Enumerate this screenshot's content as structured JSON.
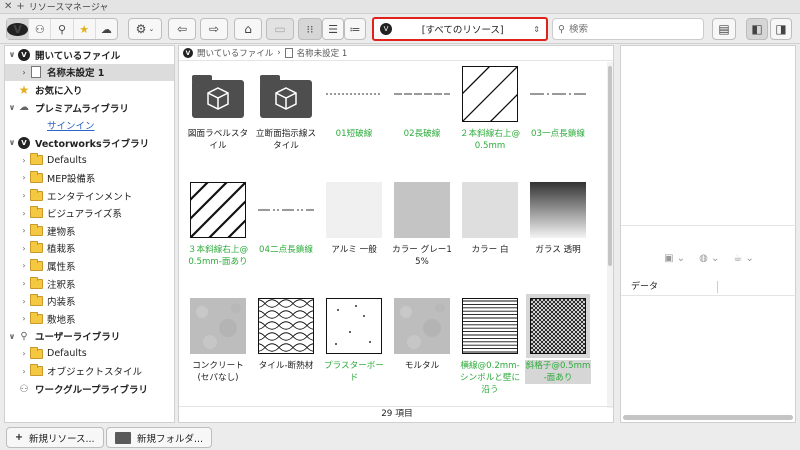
{
  "window": {
    "title": "リソースマネージャ"
  },
  "toolbar": {
    "dropdown_label": "[すべてのリソース]",
    "search_placeholder": "検索"
  },
  "sidebar": {
    "items": [
      {
        "label": "開いているファイル",
        "level": 0,
        "arrow": "∨",
        "icon": "vw-logo",
        "bold": true
      },
      {
        "label": "名称未設定 1",
        "level": 1,
        "arrow": "›",
        "icon": "document-icon",
        "bold": true,
        "selected": true
      },
      {
        "label": "お気に入り",
        "level": 0,
        "arrow": "",
        "icon": "star-icon",
        "bold": true
      },
      {
        "label": "プレミアムライブラリ",
        "level": 0,
        "arrow": "∨",
        "icon": "cloud-icon",
        "bold": true
      },
      {
        "label": "サインイン",
        "level": 1,
        "arrow": "",
        "icon": "",
        "link": true
      },
      {
        "label": "Vectorworksライブラリ",
        "level": 0,
        "arrow": "∨",
        "icon": "vw-logo",
        "bold": true
      },
      {
        "label": "Defaults",
        "level": 1,
        "arrow": "›",
        "icon": "folder-icon"
      },
      {
        "label": "MEP設備系",
        "level": 1,
        "arrow": "›",
        "icon": "folder-icon"
      },
      {
        "label": "エンタテインメント",
        "level": 1,
        "arrow": "›",
        "icon": "folder-icon"
      },
      {
        "label": "ビジュアライズ系",
        "level": 1,
        "arrow": "›",
        "icon": "folder-icon"
      },
      {
        "label": "建物系",
        "level": 1,
        "arrow": "›",
        "icon": "folder-icon"
      },
      {
        "label": "植栽系",
        "level": 1,
        "arrow": "›",
        "icon": "folder-icon"
      },
      {
        "label": "属性系",
        "level": 1,
        "arrow": "›",
        "icon": "folder-icon"
      },
      {
        "label": "注釈系",
        "level": 1,
        "arrow": "›",
        "icon": "folder-icon"
      },
      {
        "label": "内装系",
        "level": 1,
        "arrow": "›",
        "icon": "folder-icon"
      },
      {
        "label": "敷地系",
        "level": 1,
        "arrow": "›",
        "icon": "folder-icon"
      },
      {
        "label": "ユーザーライブラリ",
        "level": 0,
        "arrow": "∨",
        "icon": "user-icon",
        "bold": true
      },
      {
        "label": "Defaults",
        "level": 1,
        "arrow": "›",
        "icon": "folder-icon"
      },
      {
        "label": "オブジェクトスタイル",
        "level": 1,
        "arrow": "›",
        "icon": "folder-icon"
      },
      {
        "label": "ワークグループライブラリ",
        "level": 0,
        "arrow": "",
        "icon": "group-icon",
        "bold": true
      }
    ]
  },
  "breadcrumb": {
    "root": "開いているファイル",
    "current": "名称未設定 1"
  },
  "resources": [
    {
      "label": "図面ラベルスタイル",
      "thumb": "folder",
      "color": "black"
    },
    {
      "label": "立断面指示線スタイル",
      "thumb": "folder",
      "color": "black"
    },
    {
      "label": "01短破線",
      "thumb": "dash-short",
      "color": "green"
    },
    {
      "label": "02長破線",
      "thumb": "dash-long",
      "color": "green"
    },
    {
      "label": "２本斜線右上@0.5mm",
      "thumb": "diag-double",
      "color": "green"
    },
    {
      "label": "03一点長鎖線",
      "thumb": "dash-dot",
      "color": "green"
    },
    {
      "label": "３本斜線右上@0.5mm-面あり",
      "thumb": "diag-triple",
      "color": "green"
    },
    {
      "label": "04二点長鎖線",
      "thumb": "dash-dot2",
      "color": "green"
    },
    {
      "label": "アルミ 一般",
      "thumb": "solid-lighter",
      "color": "black"
    },
    {
      "label": "カラー グレー15%",
      "thumb": "solid-gray",
      "color": "black"
    },
    {
      "label": "カラー 白",
      "thumb": "solid-light",
      "color": "black"
    },
    {
      "label": "ガラス 透明",
      "thumb": "gradient",
      "color": "black"
    },
    {
      "label": "コンクリート (セパなし)",
      "thumb": "concrete",
      "color": "black"
    },
    {
      "label": "タイル-断熱材",
      "thumb": "insulation",
      "color": "black"
    },
    {
      "label": "プラスターボード",
      "thumb": "plaster",
      "color": "green"
    },
    {
      "label": "モルタル",
      "thumb": "concrete",
      "color": "black"
    },
    {
      "label": "横線@0.2mm-シンボルと壁に沿う",
      "thumb": "hlines",
      "color": "green"
    },
    {
      "label": "斜格子@0.5mm-面あり",
      "thumb": "crosshatch",
      "color": "green",
      "selected": true
    }
  ],
  "status": {
    "count": "29 項目"
  },
  "right_panel": {
    "data_header": "データ"
  },
  "bottom": {
    "new_resource": "新規リソース...",
    "new_folder": "新規フォルダ..."
  }
}
